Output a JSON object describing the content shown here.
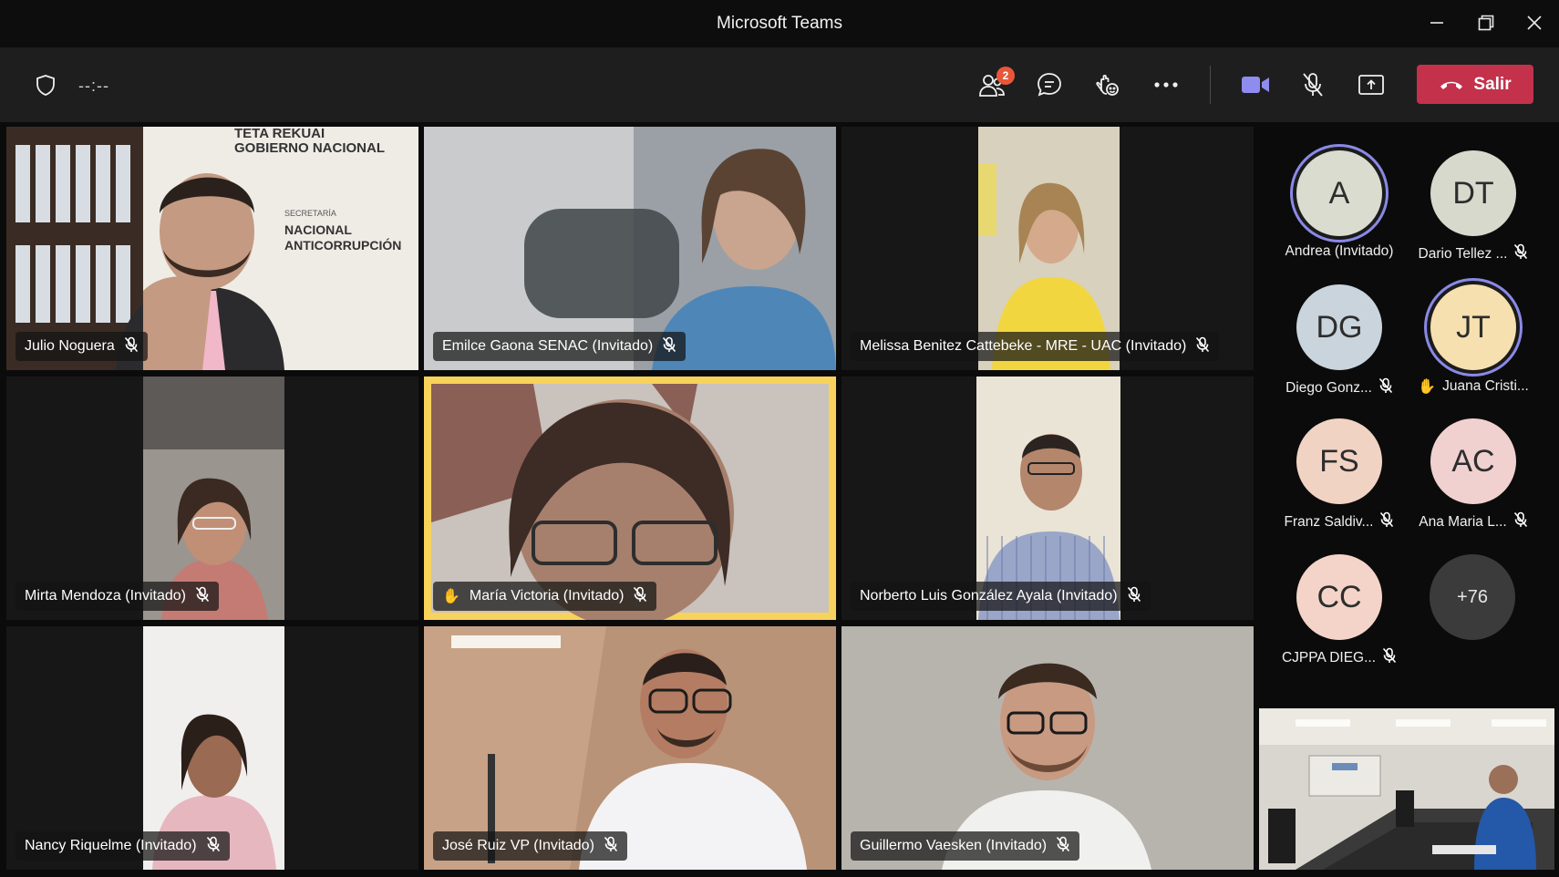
{
  "window": {
    "title": "Microsoft Teams"
  },
  "toolbar": {
    "timer": "--:--",
    "participants_badge": "2",
    "leave_label": "Salir"
  },
  "tiles": [
    {
      "name": "Julio Noguera",
      "muted": true,
      "hand_raised": false,
      "highlighted": false,
      "bg": "#5a4a3c",
      "backdrop_text": [
        "TETA REKUAI",
        "GOBIERNO NACIONAL",
        "SECRETARÍA",
        "NACIONAL",
        "ANTICORRUPCIÓN"
      ]
    },
    {
      "name": "Emilce Gaona SENAC (Invitado)",
      "muted": true,
      "hand_raised": false,
      "highlighted": false,
      "bg": "#8a8f94"
    },
    {
      "name": "Melissa Benitez Cattebeke - MRE - UAC (Invitado)",
      "muted": true,
      "hand_raised": false,
      "highlighted": false,
      "bg": "#b6b09b"
    },
    {
      "name": "Mirta Mendoza (Invitado)",
      "muted": true,
      "hand_raised": false,
      "highlighted": false,
      "bg": "#8b857f"
    },
    {
      "name": "María Victoria (Invitado)",
      "muted": true,
      "hand_raised": true,
      "highlighted": true,
      "bg": "#7b716c"
    },
    {
      "name": "Norberto Luis González Ayala (Invitado)",
      "muted": true,
      "hand_raised": false,
      "highlighted": false,
      "bg": "#c9c2b3"
    },
    {
      "name": "Nancy Riquelme (Invitado)",
      "muted": true,
      "hand_raised": false,
      "highlighted": false,
      "bg": "#c8c4c0"
    },
    {
      "name": "José Ruiz VP (Invitado)",
      "muted": true,
      "hand_raised": false,
      "highlighted": false,
      "bg": "#a88a72"
    },
    {
      "name": "Guillermo Vaesken (Invitado)",
      "muted": true,
      "hand_raised": false,
      "highlighted": false,
      "bg": "#b5b2ab"
    }
  ],
  "roster": [
    {
      "initials": "A",
      "label": "Andrea (Invitado)",
      "color": "#d9dccf",
      "speaking": true,
      "muted": false,
      "hand_raised": false
    },
    {
      "initials": "DT",
      "label": "Dario Tellez ...",
      "color": "#d6d9cc",
      "speaking": false,
      "muted": true,
      "hand_raised": false
    },
    {
      "initials": "DG",
      "label": "Diego Gonz...",
      "color": "#c9d4dc",
      "speaking": false,
      "muted": true,
      "hand_raised": false
    },
    {
      "initials": "JT",
      "label": "Juana Cristi...",
      "color": "#f6e0b0",
      "speaking": true,
      "muted": false,
      "hand_raised": true
    },
    {
      "initials": "FS",
      "label": "Franz Saldiv...",
      "color": "#f1d3c4",
      "speaking": false,
      "muted": true,
      "hand_raised": false
    },
    {
      "initials": "AC",
      "label": "Ana Maria L...",
      "color": "#f1d0d0",
      "speaking": false,
      "muted": true,
      "hand_raised": false
    },
    {
      "initials": "CC",
      "label": "CJPPA DIEG...",
      "color": "#f4d4c8",
      "speaking": false,
      "muted": true,
      "hand_raised": false
    }
  ],
  "overflow": {
    "label": "+76"
  }
}
